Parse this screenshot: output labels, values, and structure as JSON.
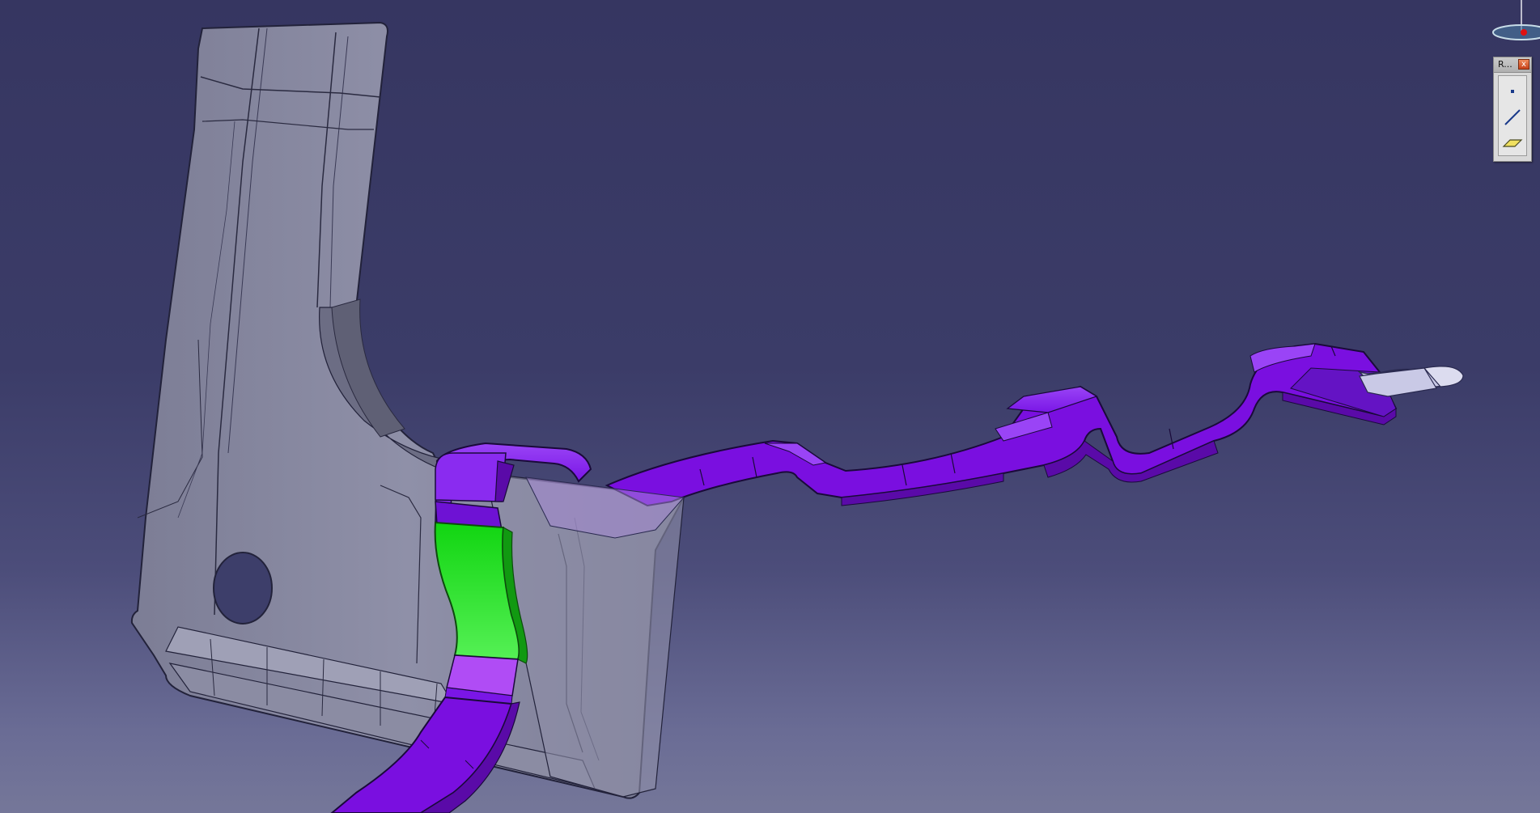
{
  "viewer": {
    "background_top": "#363661",
    "background_bottom": "#757799"
  },
  "parts": {
    "bracket_color": "#8e8fa6",
    "bracket_edge": "#222233",
    "strap_color": "#7a0fe0",
    "strap_top": "#8a2bf0",
    "strap_side": "#5a0aa8",
    "selected_face_color": "#22e622",
    "highlight_face_color": "#b04cf5",
    "end_tab_color": "#c9c9e6"
  },
  "palette": {
    "title": "R...",
    "close_glyph": "x",
    "tools": [
      {
        "icon": "point-icon"
      },
      {
        "icon": "line-icon"
      },
      {
        "icon": "plane-icon"
      }
    ]
  }
}
